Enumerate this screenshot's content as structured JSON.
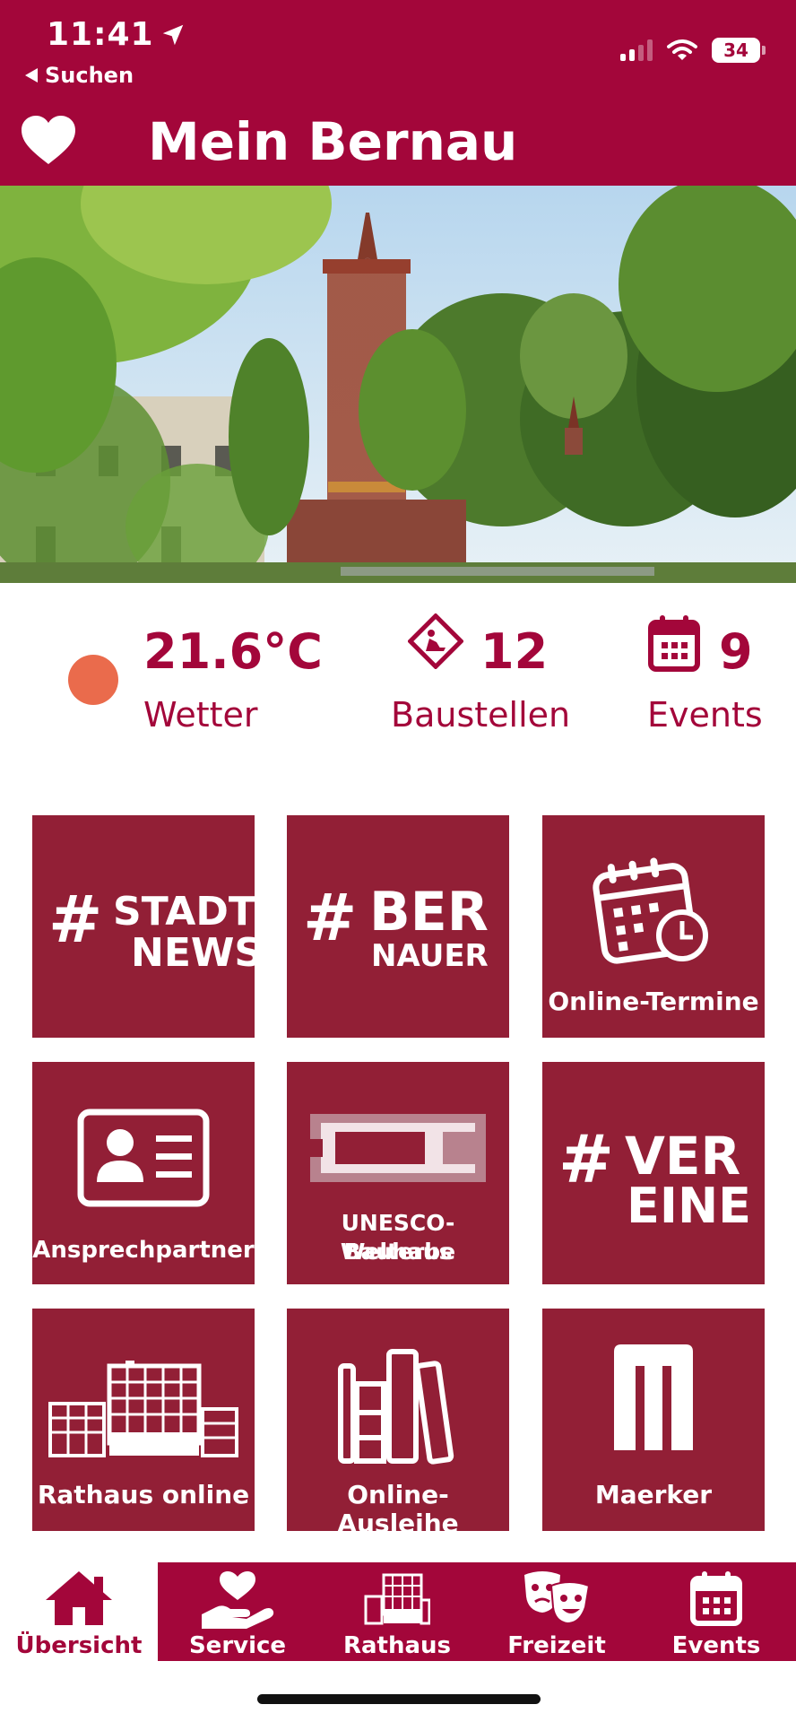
{
  "status_bar": {
    "time": "11:41",
    "back_label": "Suchen",
    "battery": "34"
  },
  "header": {
    "title": "Mein Bernau"
  },
  "stats": {
    "weather": {
      "value": "21.6°C",
      "label": "Wetter"
    },
    "construction": {
      "value": "12",
      "label": "Baustellen"
    },
    "events": {
      "value": "9",
      "label": "Events"
    }
  },
  "tiles": {
    "stadtnews": {
      "hash": "#",
      "line1": "STADT",
      "line2": "NEWS"
    },
    "bernauer": {
      "hash": "#",
      "line1": "BER",
      "line2": "NAUER"
    },
    "online_termine": {
      "label": "Online-Termine"
    },
    "ansprechpartner": {
      "label": "Ansprechpartner"
    },
    "unesco": {
      "line1": "UNESCO-Welterbe",
      "line2": "Bauhaus"
    },
    "vereine": {
      "hash": "#",
      "line1": "VER",
      "line2": "EINE"
    },
    "rathaus_online": {
      "label": "Rathaus online"
    },
    "online_ausleihe": {
      "label": "Online-Ausleihe"
    },
    "maerker": {
      "label": "Maerker"
    }
  },
  "tabbar": {
    "tabs": [
      {
        "label": "Übersicht",
        "icon": "home-icon",
        "active": true
      },
      {
        "label": "Service",
        "icon": "heart-hand-icon"
      },
      {
        "label": "Rathaus",
        "icon": "building-icon"
      },
      {
        "label": "Freizeit",
        "icon": "theater-masks-icon"
      },
      {
        "label": "Events",
        "icon": "calendar-icon"
      }
    ]
  },
  "colors": {
    "brand": "#a3063a",
    "tile": "#921f36",
    "weather_dot": "#ea6b4c"
  }
}
